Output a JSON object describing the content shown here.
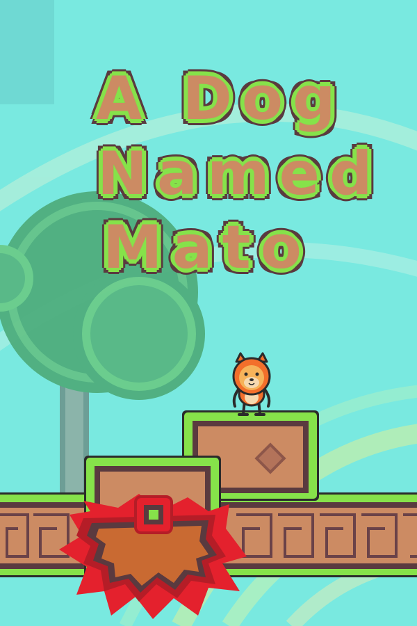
{
  "title": {
    "line1": "A Dog",
    "line2": "Named",
    "line3": "Mato"
  },
  "colors": {
    "sky": "#79e9e0",
    "title_fill": "#cc8b63",
    "title_outline_green": "#86e24a",
    "title_outline_dark": "#5a3a3f",
    "grass_green": "#86e24a",
    "block_brown": "#cc8b63",
    "hazard_red": "#e4212d",
    "character_orange": "#f36f2b"
  },
  "scene": {
    "character_icon": "dog-character-icon",
    "tree_icon": "tree-icon",
    "hazard_icon": "spiky-lava-hazard-icon"
  }
}
